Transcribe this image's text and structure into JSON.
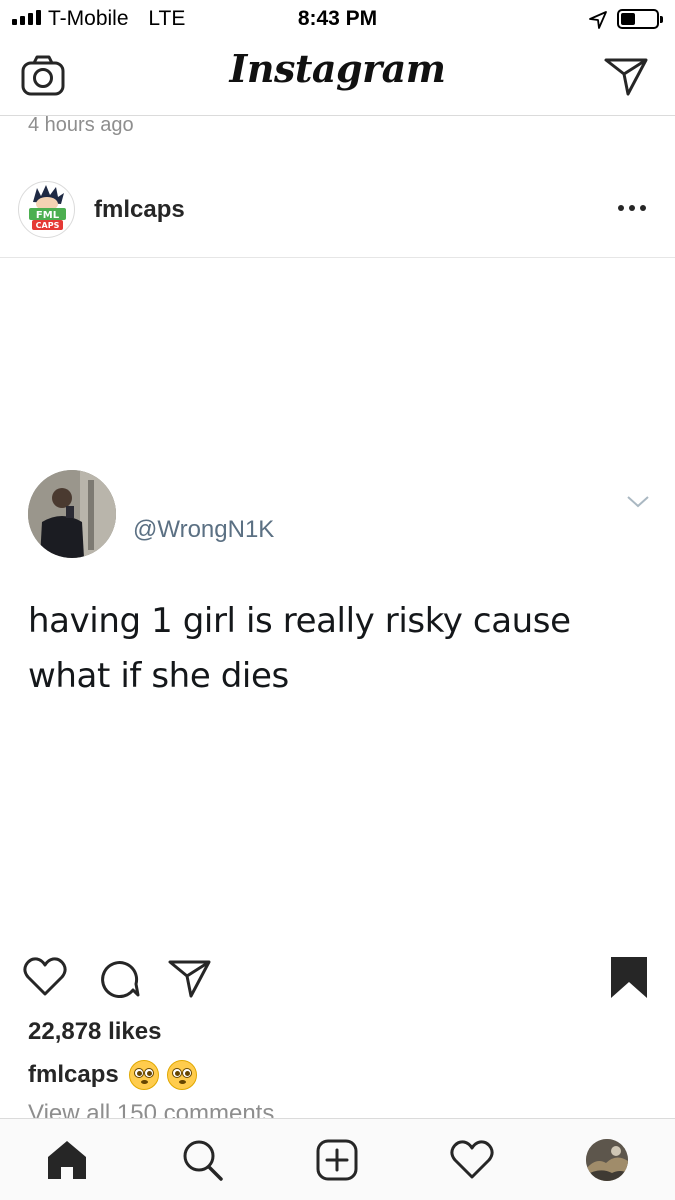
{
  "status_bar": {
    "carrier": "T-Mobile",
    "network": "LTE",
    "time": "8:43 PM",
    "battery_level": 0.4
  },
  "header": {
    "logo_text": "Instagram",
    "camera_icon": "camera-icon",
    "direct_icon": "paper-plane-icon"
  },
  "timestamp": "4 hours ago",
  "post": {
    "username": "fmlcaps",
    "avatar_text": [
      "FML",
      "CAPS"
    ],
    "more_icon": "more-horizontal-icon",
    "tweet": {
      "handle": "@WrongN1K",
      "text": "having 1 girl is really risky cause what if she dies",
      "chevron_icon": "chevron-down-icon"
    },
    "likes": "22,878 likes",
    "caption_user": "fmlcaps",
    "caption_emoji": [
      "flushed-face-emoji",
      "flushed-face-emoji"
    ],
    "view_comments": "View all 150 comments"
  },
  "actions": [
    "heart-icon",
    "comment-icon",
    "share-icon",
    "bookmark-icon"
  ],
  "tab_bar": [
    "home-icon",
    "search-icon",
    "add-post-icon",
    "activity-heart-icon",
    "profile-avatar"
  ]
}
